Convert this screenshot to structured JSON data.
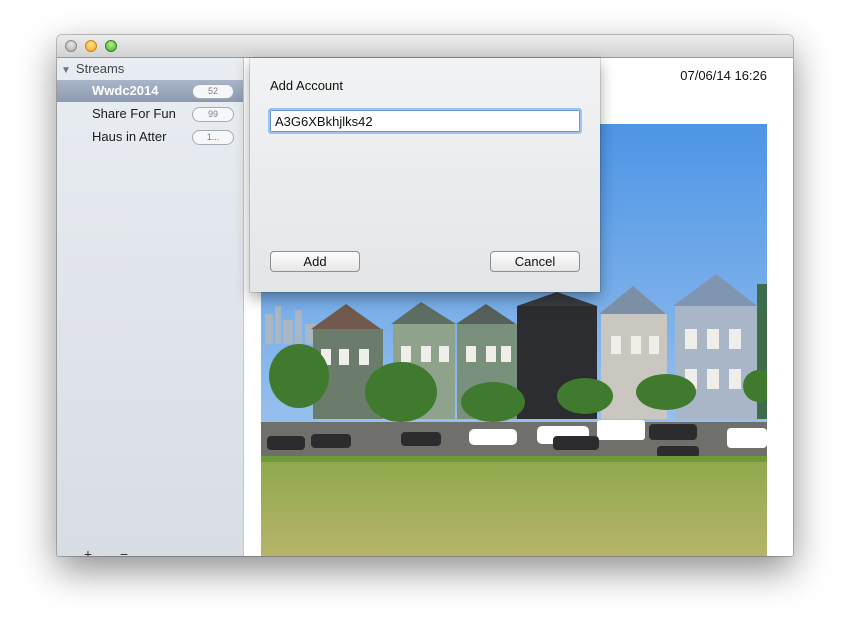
{
  "window": {
    "controls": [
      {
        "name": "close-button"
      },
      {
        "name": "minimize-button"
      },
      {
        "name": "zoom-button"
      }
    ]
  },
  "sidebar": {
    "header": "Streams",
    "items": [
      {
        "label": "Wwdc2014",
        "badge": "52",
        "selected": true
      },
      {
        "label": "Share For Fun",
        "badge": "99",
        "selected": false
      },
      {
        "label": "Haus in Atter",
        "badge": "1...",
        "selected": false
      }
    ],
    "add_label": "+",
    "remove_label": "−"
  },
  "content": {
    "timestamp": "07/06/14 16:26"
  },
  "sheet": {
    "title": "Add Account",
    "account_value": "A3G6XBkhjlks42",
    "add_label": "Add",
    "cancel_label": "Cancel"
  },
  "colors": {
    "selection": "#8b9ab0",
    "focus_ring": "#6c9ad8",
    "sky": "#6aa7e8",
    "grass": "#a7ae55"
  }
}
